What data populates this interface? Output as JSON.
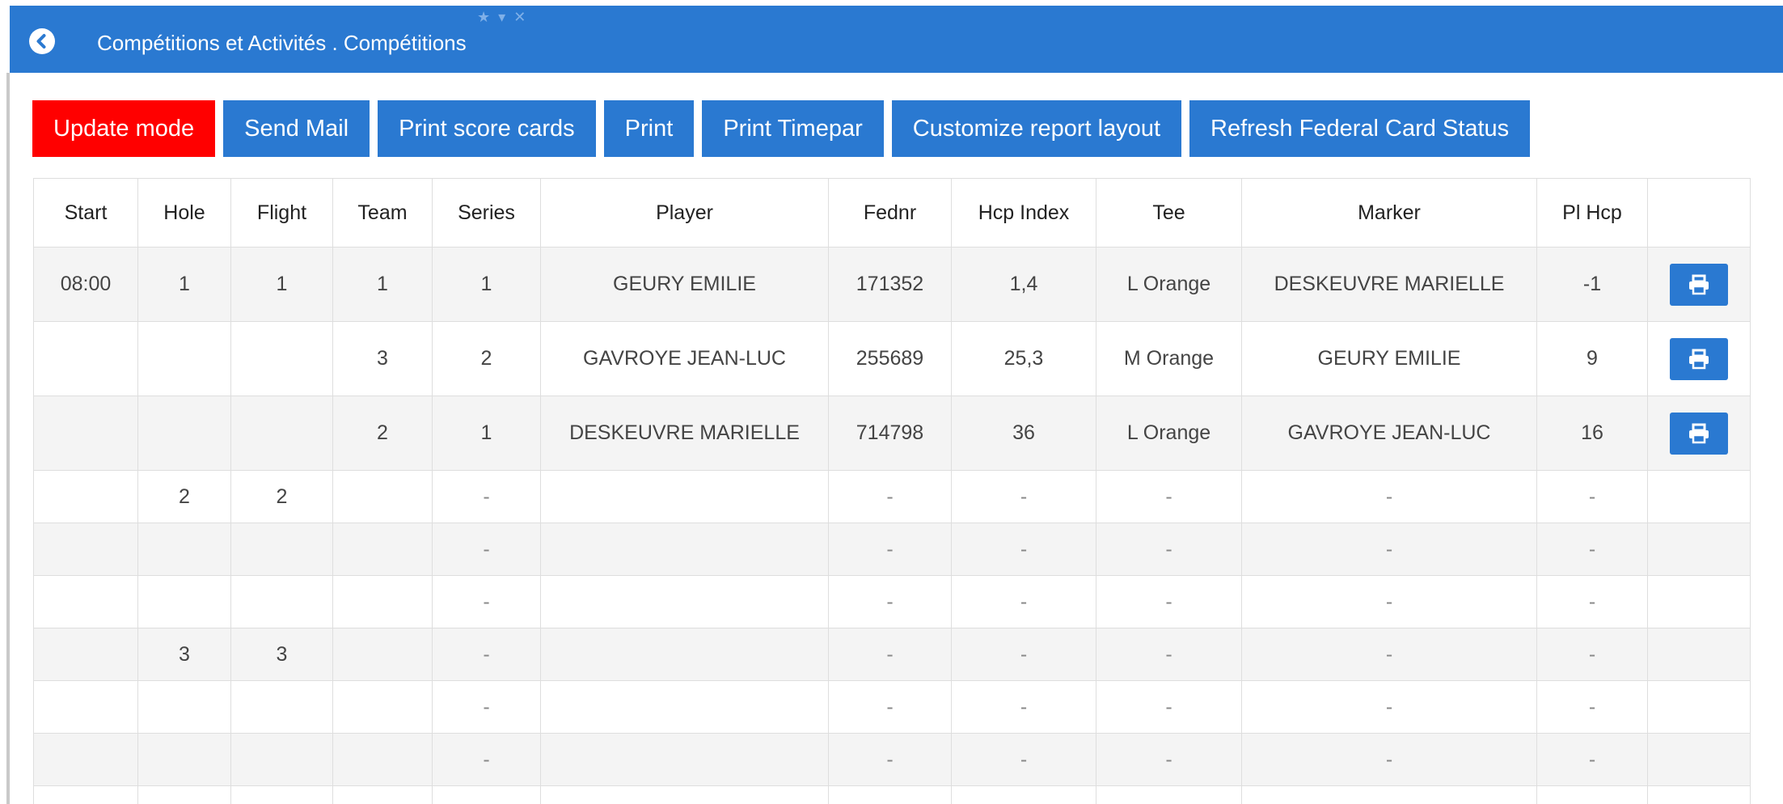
{
  "header": {
    "title": "Compétitions et Activités . Compétitions",
    "back_icon": "circle-chevron-left-icon",
    "window_controls": [
      "★",
      "▾",
      "✕"
    ]
  },
  "toolbar": {
    "update_mode": "Update mode",
    "send_mail": "Send Mail",
    "print_score_cards": "Print score cards",
    "print": "Print",
    "print_timepar": "Print Timepar",
    "customize_report_layout": "Customize report layout",
    "refresh_federal_card_status": "Refresh Federal Card Status"
  },
  "colors": {
    "brand_blue": "#2a79d1",
    "update_red": "#ff0000",
    "row_stripe": "#f4f4f4"
  },
  "table": {
    "columns": [
      "Start",
      "Hole",
      "Flight",
      "Team",
      "Series",
      "Player",
      "Fednr",
      "Hcp Index",
      "Tee",
      "Marker",
      "Pl Hcp",
      ""
    ],
    "rows": [
      [
        "08:00",
        "1",
        "1",
        "1",
        "1",
        "GEURY EMILIE",
        "171352",
        "1,4",
        "L Orange",
        "DESKEUVRE MARIELLE",
        "-1",
        "print"
      ],
      [
        "",
        "",
        "",
        "3",
        "2",
        "GAVROYE JEAN-LUC",
        "255689",
        "25,3",
        "M Orange",
        "GEURY EMILIE",
        "9",
        "print"
      ],
      [
        "",
        "",
        "",
        "2",
        "1",
        "DESKEUVRE MARIELLE",
        "714798",
        "36",
        "L Orange",
        "GAVROYE JEAN-LUC",
        "16",
        "print"
      ],
      [
        "",
        "2",
        "2",
        "",
        "-",
        "",
        "-",
        "-",
        "-",
        "-",
        "-",
        ""
      ],
      [
        "",
        "",
        "",
        "",
        "-",
        "",
        "-",
        "-",
        "-",
        "-",
        "-",
        ""
      ],
      [
        "",
        "",
        "",
        "",
        "-",
        "",
        "-",
        "-",
        "-",
        "-",
        "-",
        ""
      ],
      [
        "",
        "3",
        "3",
        "",
        "-",
        "",
        "-",
        "-",
        "-",
        "-",
        "-",
        ""
      ],
      [
        "",
        "",
        "",
        "",
        "-",
        "",
        "-",
        "-",
        "-",
        "-",
        "-",
        ""
      ],
      [
        "",
        "",
        "",
        "",
        "-",
        "",
        "-",
        "-",
        "-",
        "-",
        "-",
        ""
      ],
      [
        "",
        "",
        "",
        "",
        "",
        "",
        "",
        "",
        "",
        "",
        "",
        ""
      ]
    ],
    "print_icon": "printer-icon"
  }
}
